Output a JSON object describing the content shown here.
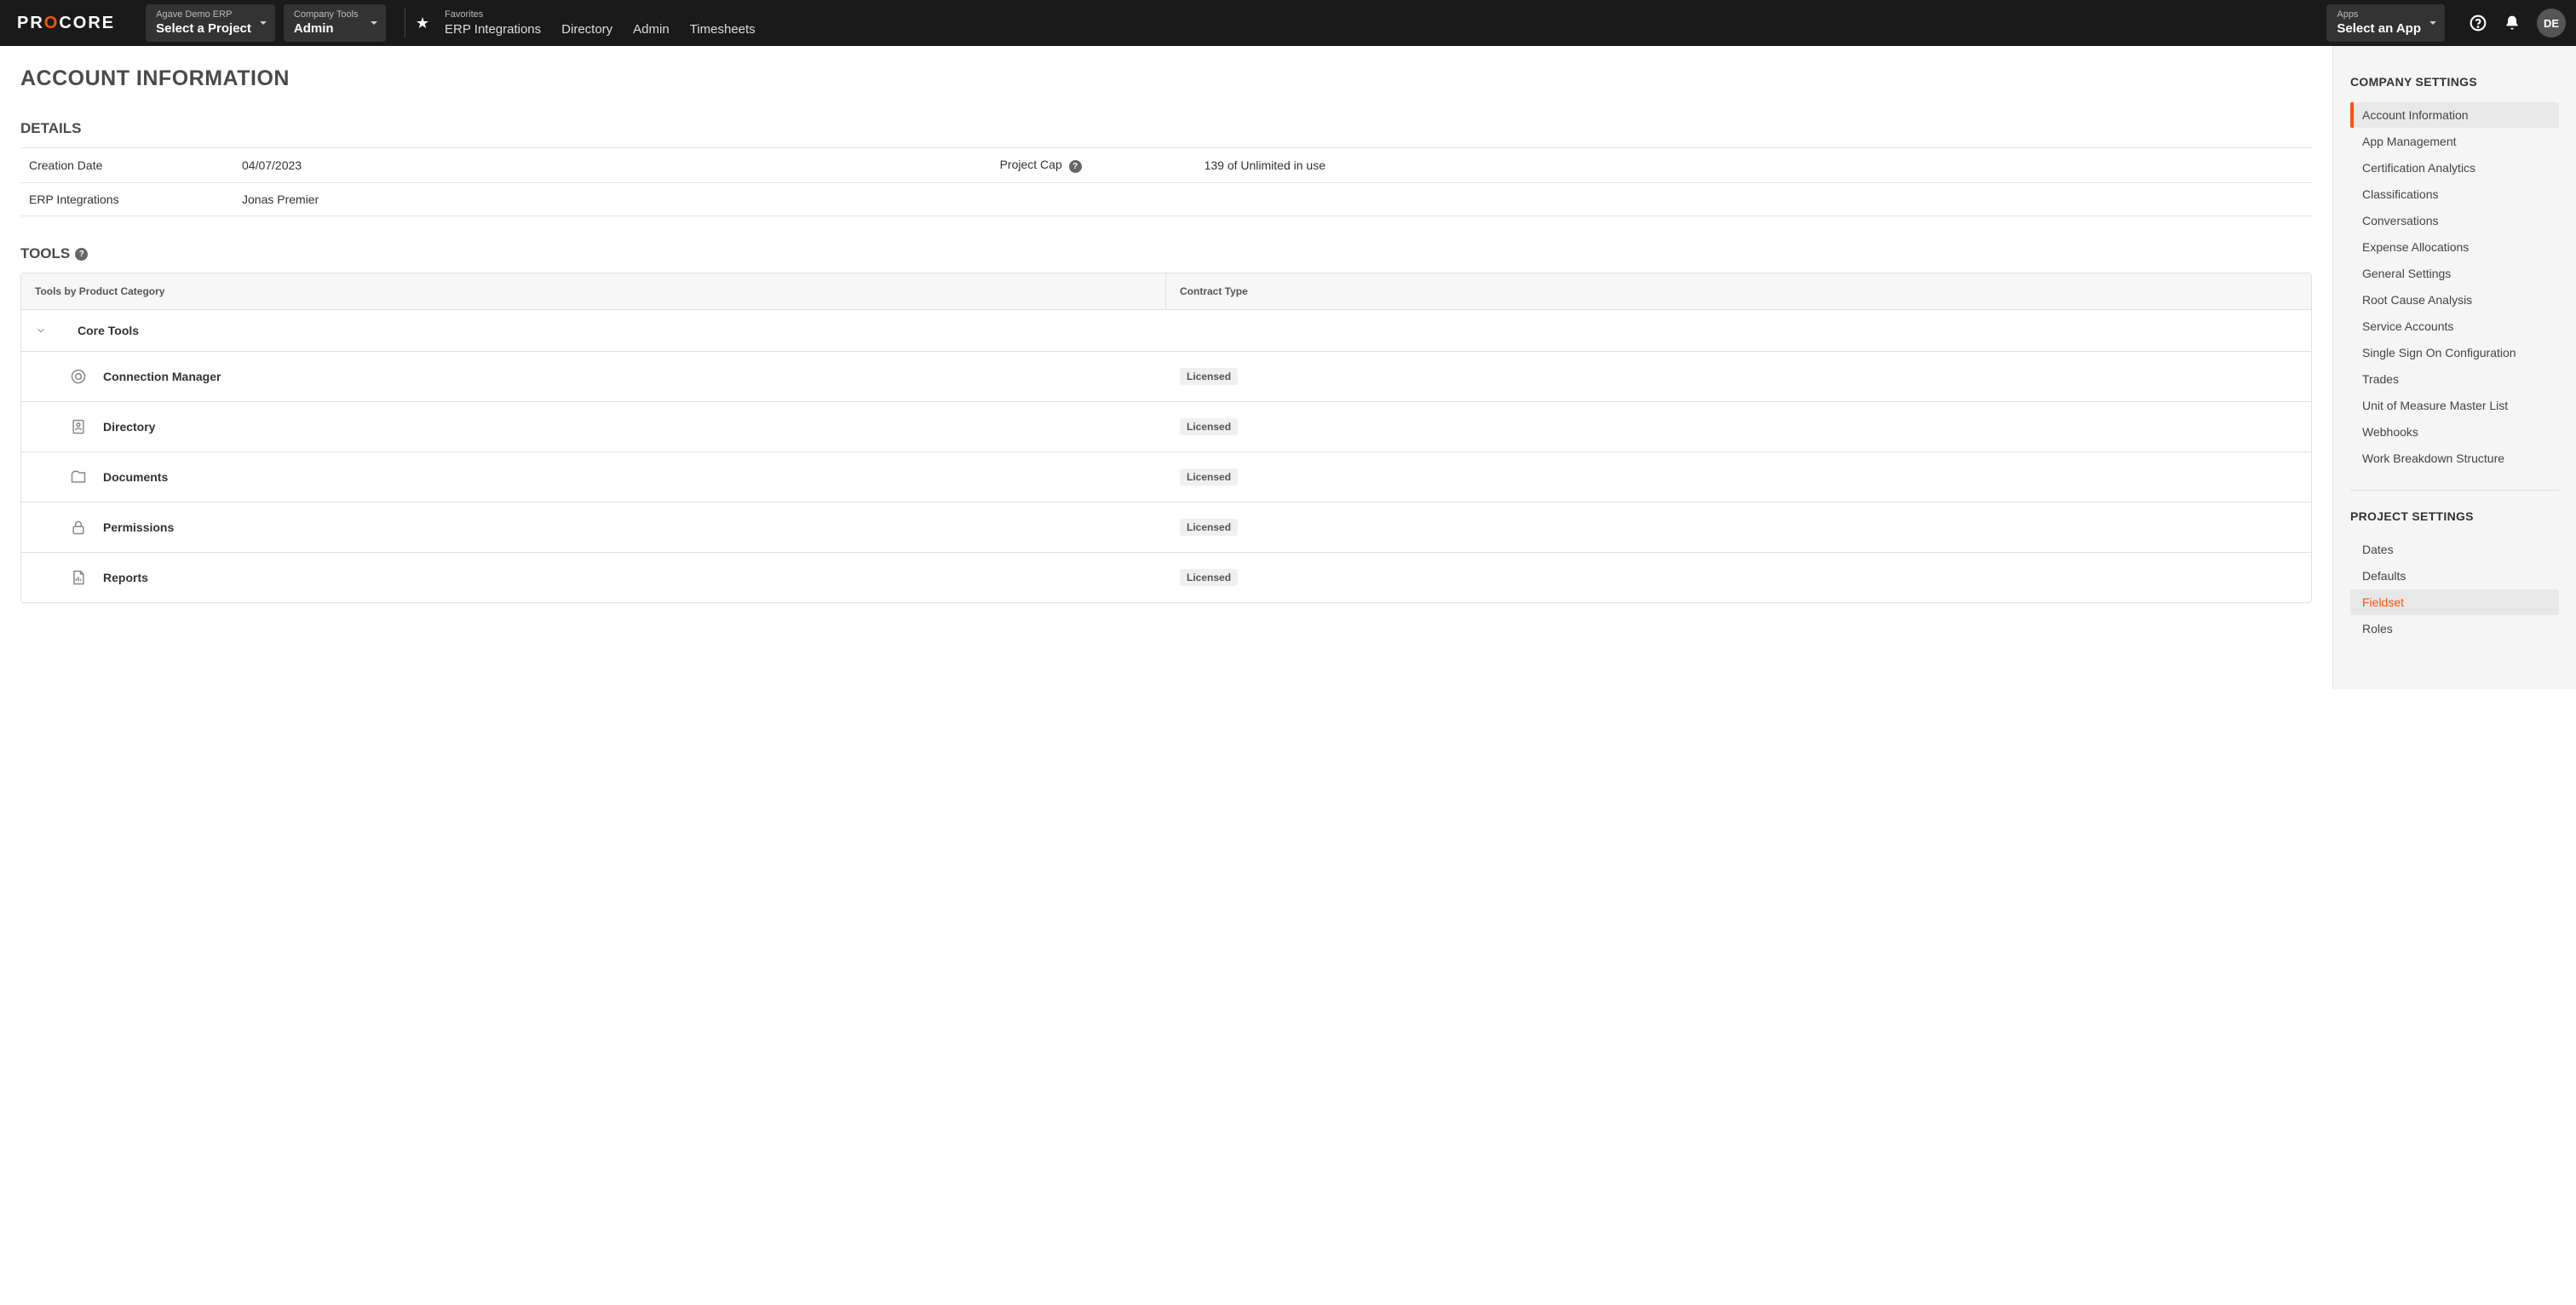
{
  "topbar": {
    "logo_pre": "PR",
    "logo_accent": "O",
    "logo_post": "CORE",
    "project_selector": {
      "label": "Agave Demo ERP",
      "value": "Select a Project"
    },
    "tools_selector": {
      "label": "Company Tools",
      "value": "Admin"
    },
    "favorites_label": "Favorites",
    "favorites": [
      "ERP Integrations",
      "Directory",
      "Admin",
      "Timesheets"
    ],
    "apps_selector": {
      "label": "Apps",
      "value": "Select an App"
    },
    "avatar_initials": "DE"
  },
  "page_title": "ACCOUNT INFORMATION",
  "details": {
    "heading": "DETAILS",
    "rows": [
      {
        "label": "Creation Date",
        "value": "04/07/2023",
        "label2": "Project Cap",
        "value2": "139 of Unlimited in use",
        "help": true
      },
      {
        "label": "ERP Integrations",
        "value": "Jonas Premier",
        "label2": "",
        "value2": "",
        "help": false
      }
    ]
  },
  "tools_section": {
    "heading": "TOOLS",
    "col_left": "Tools by Product Category",
    "col_right": "Contract Type",
    "group_name": "Core Tools",
    "rows": [
      {
        "icon": "connection",
        "name": "Connection Manager",
        "badge": "Licensed"
      },
      {
        "icon": "directory",
        "name": "Directory",
        "badge": "Licensed"
      },
      {
        "icon": "documents",
        "name": "Documents",
        "badge": "Licensed"
      },
      {
        "icon": "permissions",
        "name": "Permissions",
        "badge": "Licensed"
      },
      {
        "icon": "reports",
        "name": "Reports",
        "badge": "Licensed"
      }
    ]
  },
  "sidebar": {
    "company_heading": "COMPANY SETTINGS",
    "company_items": [
      "Account Information",
      "App Management",
      "Certification Analytics",
      "Classifications",
      "Conversations",
      "Expense Allocations",
      "General Settings",
      "Root Cause Analysis",
      "Service Accounts",
      "Single Sign On Configuration",
      "Trades",
      "Unit of Measure Master List",
      "Webhooks",
      "Work Breakdown Structure"
    ],
    "project_heading": "PROJECT SETTINGS",
    "project_items": [
      "Dates",
      "Defaults",
      "Fieldset",
      "Roles"
    ]
  }
}
